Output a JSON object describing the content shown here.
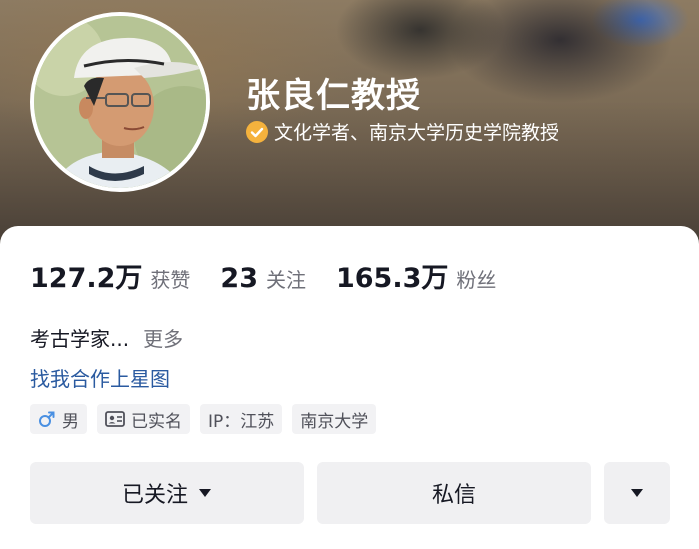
{
  "profile": {
    "name": "张良仁教授",
    "verification": "文化学者、南京大学历史学院教授",
    "stats": [
      {
        "value": "127.2万",
        "label": "获赞"
      },
      {
        "value": "23",
        "label": "关注"
      },
      {
        "value": "165.3万",
        "label": "粉丝"
      }
    ],
    "bio": "考古学家...",
    "bio_more": "更多",
    "link_text": "找我合作上星图",
    "tags": [
      {
        "icon": "male-icon",
        "text": "男"
      },
      {
        "icon": "id-card-icon",
        "text": "已实名"
      },
      {
        "icon": "",
        "text": "IP：江苏"
      },
      {
        "icon": "",
        "text": "南京大学"
      }
    ]
  },
  "actions": {
    "follow_label": "已关注",
    "message_label": "私信"
  },
  "colors": {
    "verify_badge": "#f5b23d",
    "link": "#2a5aa0",
    "male_icon": "#4a90e2",
    "button_bg": "#f0f0f2"
  }
}
